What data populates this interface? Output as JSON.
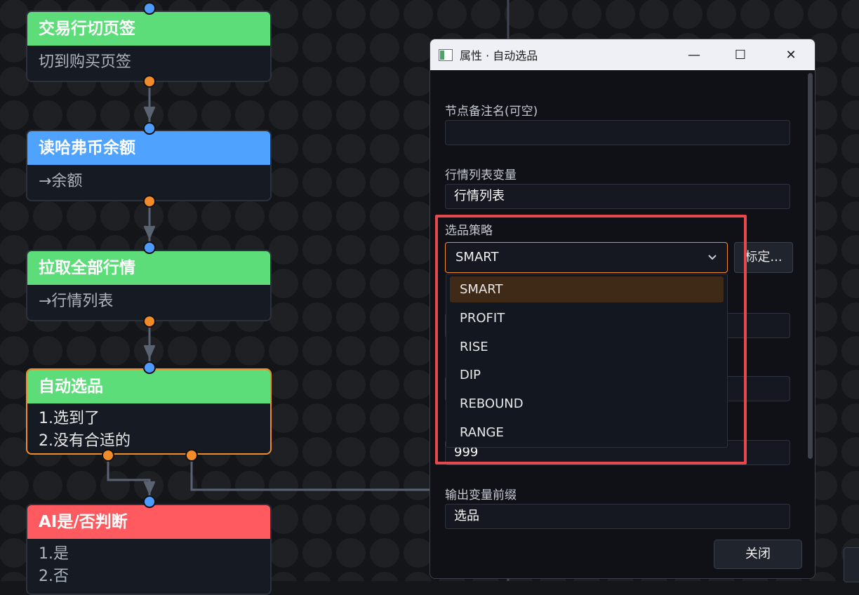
{
  "nodes": [
    {
      "title": "交易行切页签",
      "body": [
        "切到购买页签"
      ],
      "color": "#5ddc7a"
    },
    {
      "title": "读哈弗币余额",
      "body": [
        "→余额"
      ],
      "color": "#4fa3ff"
    },
    {
      "title": "拉取全部行情",
      "body": [
        "→行情列表"
      ],
      "color": "#5ddc7a"
    },
    {
      "title": "自动选品",
      "body": [
        "1.选到了",
        "2.没有合适的"
      ],
      "color": "#5ddc7a"
    },
    {
      "title": "AI是/否判断",
      "body": [
        "1.是",
        "2.否"
      ],
      "color": "#ff5a5f"
    }
  ],
  "dialog": {
    "title": "属性 · 自动选品",
    "min_glyph": "—",
    "max_glyph": "☐",
    "close_glyph": "✕",
    "fields": {
      "remark_label": "节点备注名(可空)",
      "remark_value": "",
      "market_label": "行情列表变量",
      "market_value": "行情列表",
      "strategy_label": "选品策略",
      "strategy_value": "SMART",
      "calibrate_label": "标定...",
      "hidden_value": "999",
      "prefix_label": "输出变量前缀",
      "prefix_value": "选品"
    },
    "strategy_options": [
      "SMART",
      "PROFIT",
      "RISE",
      "DIP",
      "REBOUND",
      "RANGE"
    ],
    "selected_option": "SMART",
    "close_label": "关闭"
  },
  "colors": {
    "accent": "#f28c2a",
    "highlight": "#e5484d",
    "port_in": "#4e9bff",
    "port_out": "#f28c2a"
  }
}
